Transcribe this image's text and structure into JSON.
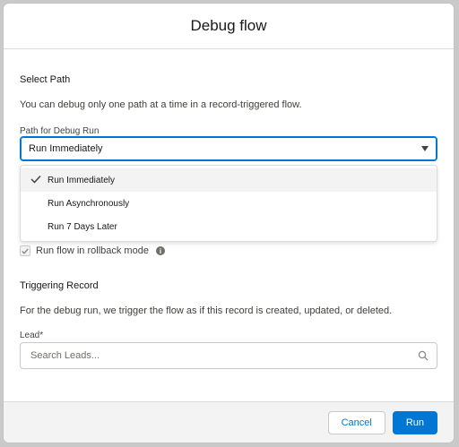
{
  "modal": {
    "title": "Debug flow"
  },
  "select_path": {
    "section_title": "Select Path",
    "description": "You can debug only one path at a time in a record-triggered flow.",
    "field_label": "Path for Debug Run",
    "selected_value": "Run Immediately",
    "options": [
      {
        "label": "Run Immediately",
        "selected": true
      },
      {
        "label": "Run Asynchronously",
        "selected": false
      },
      {
        "label": "Run 7 Days Later",
        "selected": false
      }
    ]
  },
  "rollback": {
    "label": "Run flow in rollback mode",
    "checked": true,
    "info_icon": "info-icon"
  },
  "triggering_record": {
    "section_title": "Triggering Record",
    "description": "For the debug run, we trigger the flow as if this record is created, updated, or deleted.",
    "field_label": "Lead*",
    "search_placeholder": "Search Leads...",
    "search_icon": "search-icon"
  },
  "footer": {
    "cancel_label": "Cancel",
    "run_label": "Run"
  },
  "colors": {
    "brand": "#0176d3",
    "footer_bg": "#f3f3f3",
    "overlay": "#c9c9c9"
  }
}
